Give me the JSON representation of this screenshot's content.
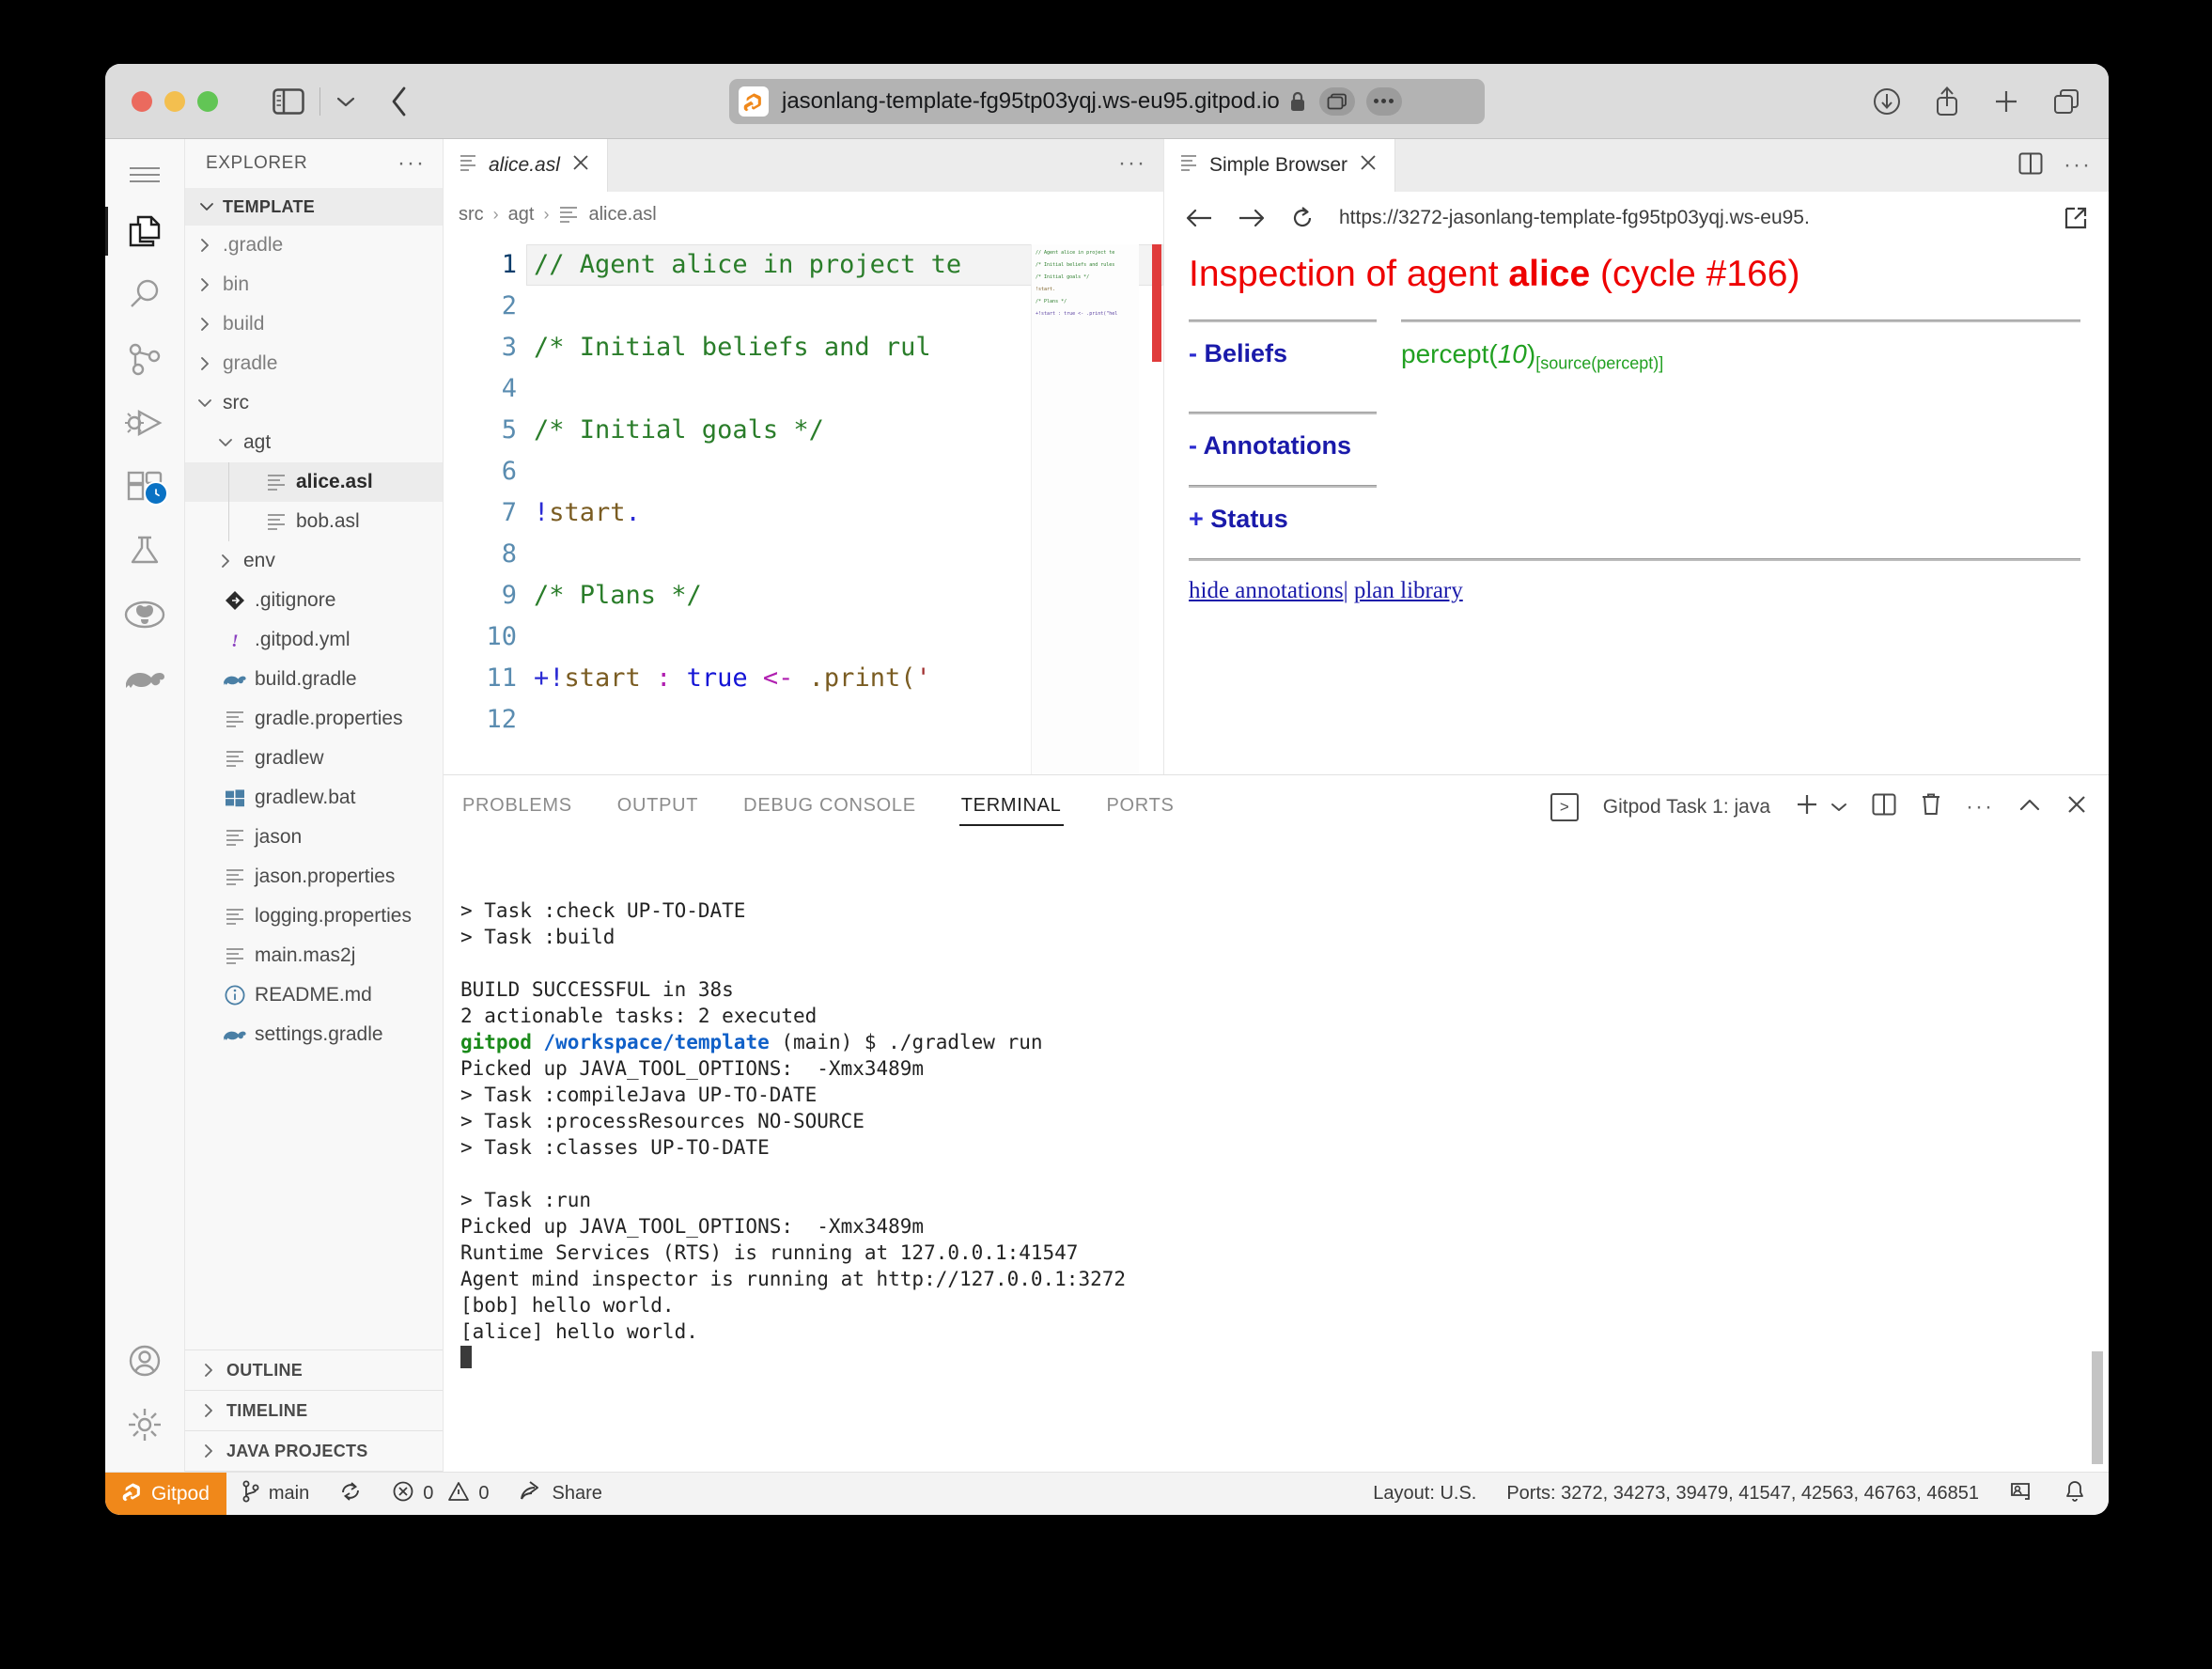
{
  "browser": {
    "url": "jasonlang-template-fg95tp03yqj.ws-eu95.gitpod.io",
    "icons": {
      "sidebar": "sidebar-toggle-icon",
      "chevron": "chevron-down-icon",
      "back": "back-chevron-icon",
      "lock": "lock-icon",
      "download": "download-icon",
      "share": "share-icon",
      "newtab": "plus-icon",
      "tabs": "tab-overview-icon"
    }
  },
  "activitybar": {
    "items": [
      {
        "name": "menu-icon",
        "label": "Menu"
      },
      {
        "name": "explorer-icon",
        "label": "Explorer"
      },
      {
        "name": "search-icon",
        "label": "Search"
      },
      {
        "name": "source-control-icon",
        "label": "Source Control"
      },
      {
        "name": "run-and-debug-icon",
        "label": "Run and Debug"
      },
      {
        "name": "extensions-icon",
        "label": "Extensions"
      },
      {
        "name": "testing-icon",
        "label": "Testing"
      },
      {
        "name": "github-icon",
        "label": "GitHub"
      },
      {
        "name": "gradle-icon",
        "label": "Gradle"
      }
    ],
    "account_icon": "account-icon",
    "settings_icon": "settings-gear-icon"
  },
  "explorer": {
    "title": "EXPLORER",
    "root": "TEMPLATE",
    "tree": [
      {
        "label": ".gradle",
        "type": "folder",
        "expanded": false,
        "depth": 1
      },
      {
        "label": "bin",
        "type": "folder",
        "expanded": false,
        "depth": 1
      },
      {
        "label": "build",
        "type": "folder",
        "expanded": false,
        "depth": 1
      },
      {
        "label": "gradle",
        "type": "folder",
        "expanded": false,
        "depth": 1
      },
      {
        "label": "src",
        "type": "folder",
        "expanded": true,
        "depth": 1
      },
      {
        "label": "agt",
        "type": "folder",
        "expanded": true,
        "depth": 2
      },
      {
        "label": "alice.asl",
        "type": "file",
        "icon": "text-file-icon",
        "depth": 3,
        "selected": true
      },
      {
        "label": "bob.asl",
        "type": "file",
        "icon": "text-file-icon",
        "depth": 3
      },
      {
        "label": "env",
        "type": "folder",
        "expanded": false,
        "depth": 2
      },
      {
        "label": ".gitignore",
        "type": "file",
        "icon": "git-icon",
        "depth": 1
      },
      {
        "label": ".gitpod.yml",
        "type": "file",
        "icon": "yaml-icon",
        "depth": 1
      },
      {
        "label": "build.gradle",
        "type": "file",
        "icon": "gradle-icon",
        "depth": 1
      },
      {
        "label": "gradle.properties",
        "type": "file",
        "icon": "text-file-icon",
        "depth": 1
      },
      {
        "label": "gradlew",
        "type": "file",
        "icon": "text-file-icon",
        "depth": 1
      },
      {
        "label": "gradlew.bat",
        "type": "file",
        "icon": "windows-icon",
        "depth": 1
      },
      {
        "label": "jason",
        "type": "file",
        "icon": "text-file-icon",
        "depth": 1
      },
      {
        "label": "jason.properties",
        "type": "file",
        "icon": "text-file-icon",
        "depth": 1
      },
      {
        "label": "logging.properties",
        "type": "file",
        "icon": "text-file-icon",
        "depth": 1
      },
      {
        "label": "main.mas2j",
        "type": "file",
        "icon": "text-file-icon",
        "depth": 1
      },
      {
        "label": "README.md",
        "type": "file",
        "icon": "info-icon",
        "depth": 1
      },
      {
        "label": "settings.gradle",
        "type": "file",
        "icon": "gradle-icon",
        "depth": 1
      }
    ],
    "bottom_sections": [
      "OUTLINE",
      "TIMELINE",
      "JAVA PROJECTS"
    ]
  },
  "editor": {
    "tab": "alice.asl",
    "breadcrumb": [
      "src",
      "agt",
      "alice.asl"
    ],
    "lines": [
      {
        "n": 1,
        "text": "// Agent alice in project te"
      },
      {
        "n": 2,
        "text": ""
      },
      {
        "n": 3,
        "text": "/* Initial beliefs and rul"
      },
      {
        "n": 4,
        "text": ""
      },
      {
        "n": 5,
        "text": "/* Initial goals */"
      },
      {
        "n": 6,
        "text": ""
      },
      {
        "n": 7,
        "text": "!start."
      },
      {
        "n": 8,
        "text": ""
      },
      {
        "n": 9,
        "text": "/* Plans */"
      },
      {
        "n": 10,
        "text": ""
      },
      {
        "n": 11,
        "text": "+!start : true <- .print('"
      },
      {
        "n": 12,
        "text": ""
      }
    ],
    "minimap_lines": [
      "// Agent alice in project te",
      "/* Initial beliefs and rules",
      "/* Initial goals */",
      "!start.",
      "/* Plans */",
      "+!start : true <- .print(\"hel"
    ]
  },
  "simple_browser": {
    "tab": "Simple Browser",
    "url": "https://3272-jasonlang-template-fg95tp03yqj.ws-eu95.",
    "icons": {
      "back": "arrow-left-icon",
      "forward": "arrow-right-icon",
      "reload": "reload-icon",
      "open_external": "open-external-icon",
      "split": "split-editor-icon",
      "more": "more-actions-icon",
      "close": "close-icon"
    },
    "page": {
      "title_prefix": "Inspection of agent ",
      "agent": "alice",
      "title_suffix": " (cycle #166)",
      "sections": [
        {
          "marker": "-",
          "label": "Beliefs"
        },
        {
          "marker": "-",
          "label": "Annotations"
        },
        {
          "marker": "+",
          "label": "Status"
        }
      ],
      "beliefs": [
        {
          "term": "percept(",
          "arg": "10",
          "close": ")",
          "annotation": "[source(percept)]"
        }
      ],
      "links": [
        "hide annotations",
        "plan library"
      ],
      "link_separator": "|"
    }
  },
  "panel": {
    "tabs": [
      "PROBLEMS",
      "OUTPUT",
      "DEBUG CONSOLE",
      "TERMINAL",
      "PORTS"
    ],
    "active_tab": "TERMINAL",
    "terminal_name": "Gitpod Task 1: java",
    "actions": {
      "new": "plus-icon",
      "new_dropdown": "chevron-down-icon",
      "split": "split-terminal-icon",
      "kill": "trash-icon",
      "more": "more-actions-icon",
      "maximize": "chevron-up-icon",
      "close": "close-icon"
    },
    "terminal_lines": [
      {
        "type": "plain",
        "text": "> Task :check UP-TO-DATE"
      },
      {
        "type": "plain",
        "text": "> Task :build"
      },
      {
        "type": "plain",
        "text": ""
      },
      {
        "type": "plain",
        "text": "BUILD SUCCESSFUL in 38s"
      },
      {
        "type": "plain",
        "text": "2 actionable tasks: 2 executed"
      },
      {
        "type": "prompt",
        "user": "gitpod",
        "path": "/workspace/template",
        "rest": " (main) $ ./gradlew run"
      },
      {
        "type": "plain",
        "text": "Picked up JAVA_TOOL_OPTIONS:  -Xmx3489m"
      },
      {
        "type": "plain",
        "text": "> Task :compileJava UP-TO-DATE"
      },
      {
        "type": "plain",
        "text": "> Task :processResources NO-SOURCE"
      },
      {
        "type": "plain",
        "text": "> Task :classes UP-TO-DATE"
      },
      {
        "type": "plain",
        "text": ""
      },
      {
        "type": "plain",
        "text": "> Task :run"
      },
      {
        "type": "plain",
        "text": "Picked up JAVA_TOOL_OPTIONS:  -Xmx3489m"
      },
      {
        "type": "plain",
        "text": "Runtime Services (RTS) is running at 127.0.0.1:41547"
      },
      {
        "type": "plain",
        "text": "Agent mind inspector is running at http://127.0.0.1:3272"
      },
      {
        "type": "plain",
        "text": "[bob] hello world."
      },
      {
        "type": "plain",
        "text": "[alice] hello world."
      }
    ]
  },
  "statusbar": {
    "gitpod": "Gitpod",
    "branch": "main",
    "sync_icon": "sync-icon",
    "errors": "0",
    "warnings": "0",
    "share": "Share",
    "layout": "Layout: U.S.",
    "ports": "Ports: 3272, 34273, 39479, 41547, 42563, 46763, 46851",
    "remote_icon": "remote-screen-icon",
    "bell_icon": "bell-icon"
  },
  "colors": {
    "accent_orange": "#f0881a",
    "gitpod_orange": "#f4861f",
    "inspector_red": "#ee0000",
    "inspector_blue": "#1a1aaa",
    "belief_green": "#21a021",
    "terminal_green": "#1a8a1a",
    "terminal_blue": "#1060c8"
  }
}
